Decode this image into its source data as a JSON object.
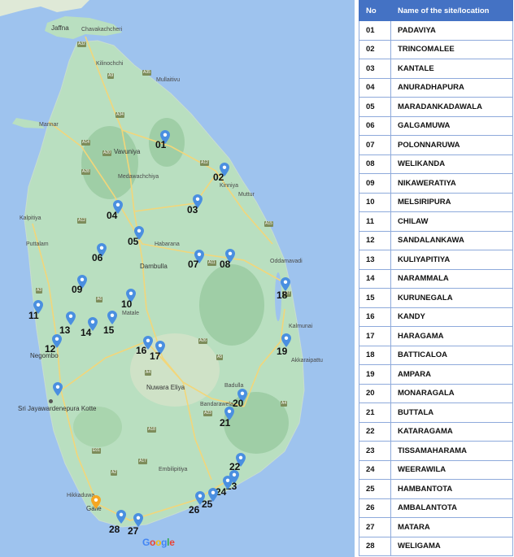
{
  "table": {
    "headers": [
      "No",
      "Name of the site/location"
    ],
    "rows": [
      [
        "01",
        "PADAVIYA"
      ],
      [
        "02",
        "TRINCOMALEE"
      ],
      [
        "03",
        "KANTALE"
      ],
      [
        "04",
        "ANURADHAPURA"
      ],
      [
        "05",
        "MARADANKADAWALA"
      ],
      [
        "06",
        "GALGAMUWA"
      ],
      [
        "07",
        "POLONNARUWA"
      ],
      [
        "08",
        "WELIKANDA"
      ],
      [
        "09",
        "NIKAWERATIYA"
      ],
      [
        "10",
        "MELSIRIPURA"
      ],
      [
        "11",
        "CHILAW"
      ],
      [
        "12",
        "SANDALANKAWA"
      ],
      [
        "13",
        "KULIYAPITIYA"
      ],
      [
        "14",
        "NARAMMALA"
      ],
      [
        "15",
        "KURUNEGALA"
      ],
      [
        "16",
        "KANDY"
      ],
      [
        "17",
        "HARAGAMA"
      ],
      [
        "18",
        "BATTICALOA"
      ],
      [
        "19",
        "AMPARA"
      ],
      [
        "20",
        "MONARAGALA"
      ],
      [
        "21",
        "BUTTALA"
      ],
      [
        "22",
        "KATARAGAMA"
      ],
      [
        "23",
        "TISSAMAHARAMA"
      ],
      [
        "24",
        "WEERAWILA"
      ],
      [
        "25",
        "HAMBANTOTA"
      ],
      [
        "26",
        "AMBALANTOTA"
      ],
      [
        "27",
        "MATARA"
      ],
      [
        "28",
        "WELIGAMA"
      ]
    ]
  },
  "markers": [
    "01",
    "02",
    "03",
    "04",
    "05",
    "06",
    "07",
    "08",
    "09",
    "10",
    "11",
    "12",
    "13",
    "14",
    "15",
    "16",
    "17",
    "18",
    "19",
    "20",
    "21",
    "22",
    "23",
    "24",
    "25",
    "26",
    "27",
    "28"
  ],
  "places": [
    "Jaffna",
    "Chavakachcheri",
    "Kilinochchi",
    "Mullaitivu",
    "Mannar",
    "Vavuniya",
    "Medawachchiya",
    "Kinniya",
    "Muttur",
    "Kalpitiya",
    "Puttalam",
    "Habarana",
    "Dambulla",
    "Oddamavadi",
    "Matale",
    "Kalmunai",
    "Akkaraipattu",
    "Negombo",
    "Sri Jayawardenepura Kotte",
    "Nuwara Eliya",
    "Badulla",
    "Bandarawela",
    "Embilipitiya",
    "Hikkaduwa",
    "Galle"
  ],
  "road_shields": [
    "A32",
    "A9",
    "A35",
    "A34",
    "A14",
    "A12",
    "A20",
    "A12",
    "A28",
    "A11",
    "A15",
    "A6",
    "A3",
    "A5",
    "A26",
    "A27",
    "A4",
    "A4",
    "A2",
    "A18",
    "A17",
    "E01",
    "A23"
  ],
  "google_logo": "Google",
  "colors": {
    "sea": "#9ec3ee",
    "land": "#b9dfc0",
    "land_forest": "#9fcea6",
    "marker": "#4a8fe0",
    "table_header": "#4472c4"
  }
}
